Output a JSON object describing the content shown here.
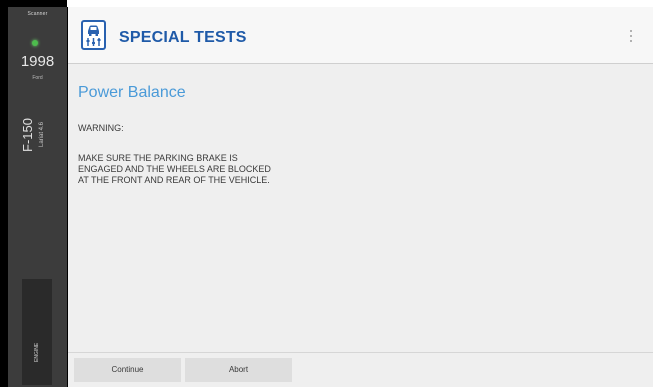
{
  "sidebar": {
    "top_label": "Scanner",
    "status_color": "#4dbd4d",
    "year": "1998",
    "make": "Ford",
    "model": "F-150",
    "engine": "Lariat 4.6",
    "engine_tab_label": "ENGINE"
  },
  "header": {
    "icon": "car-lift-icon",
    "title": "SPECIAL TESTS",
    "menu_icon": "more-vert-icon"
  },
  "content": {
    "heading": "Power Balance",
    "warning_label": "WARNING:",
    "message_lines": [
      "MAKE SURE THE PARKING BRAKE IS",
      "ENGAGED AND THE WHEELS ARE BLOCKED",
      "AT THE FRONT AND REAR OF THE VEHICLE."
    ]
  },
  "buttons": {
    "continue": "Continue",
    "abort": "Abort"
  },
  "colors": {
    "accent": "#1f5aa8",
    "heading": "#4a9ad8",
    "sidebar": "#3c3c3c"
  }
}
